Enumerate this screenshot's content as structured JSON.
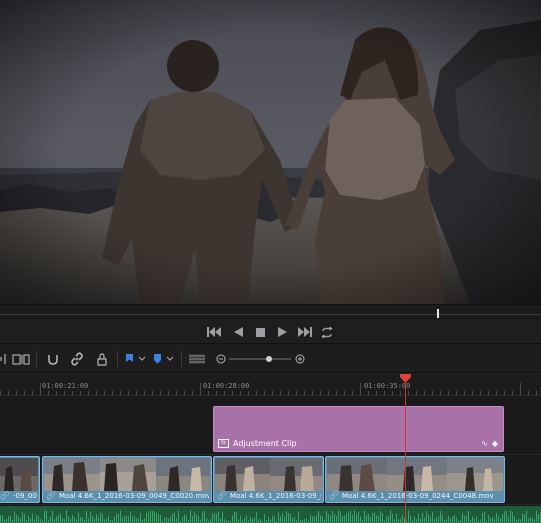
{
  "viewer": {
    "content": "video frame: couple holding hands walking on a beach at dusk"
  },
  "transport": {
    "buttons": [
      "skip-to-start",
      "play-reverse",
      "stop",
      "play",
      "skip-to-end",
      "loop"
    ]
  },
  "toolbar": {
    "tools": [
      "trim-mode",
      "dynamic-trim",
      "snapping",
      "linked-selection",
      "position-lock",
      "flag",
      "marker",
      "zoom-view",
      "zoom-slider"
    ]
  },
  "ruler": {
    "timecodes": [
      "01:00:21:00",
      "01:00:28:00",
      "01:00:35:00"
    ]
  },
  "timeline": {
    "adjustment_clip": {
      "label": "Adjustment Clip"
    },
    "clips": [
      {
        "name": "-09_0037..."
      },
      {
        "name": "Moal 4.6K_1_2016-03-09_0049_C0020.mov"
      },
      {
        "name": "Moal 4.6K_1_2016-03-09_0..."
      },
      {
        "name": "Moal 4.6K_1_2016-03-09_0244_C0048.mov"
      }
    ]
  },
  "colors": {
    "adjustment_clip": "#a872a8",
    "video_clip": "#5b8fb0",
    "audio_track": "#1f5a3a",
    "playhead": "#c83a3a"
  }
}
